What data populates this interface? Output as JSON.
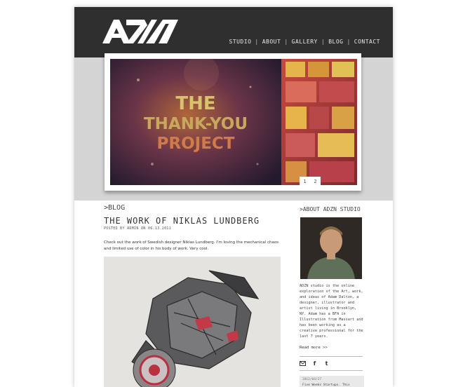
{
  "brand": {
    "logo_text": "ADZN"
  },
  "nav": {
    "items": [
      "STUDIO",
      "ABOUT",
      "GALLERY",
      "BLOG",
      "CONTACT"
    ],
    "separator": "|"
  },
  "slider": {
    "headline": [
      "THE",
      "THANK-YOU",
      "PROJECT"
    ],
    "pager": [
      "1",
      "2"
    ]
  },
  "blog": {
    "section_label": ">BLOG",
    "post": {
      "title": "THE WORK OF NIKLAS LUNDBERG",
      "meta": "POSTED BY ADMIN ON 06.13.2011",
      "body": "Check out the work of Swedish designer Niklas Lundberg. I'm loving the mechanical chaos and limited use of color in his body of work. Very cool."
    }
  },
  "sidebar": {
    "about_label": ">ABOUT ADZN STUDIO",
    "about_text": "ADZN studio is the online exploration of the Art, work, and ideas of Adam Dalton, a designer, illustrator and artist living in Brooklyn, NY. Adam has a BFA in Illustration from Massart and has been working as a creative professional for the last 7 years.",
    "read_more": "Read more >>",
    "social_icons": [
      "mail-icon",
      "facebook-icon",
      "twitter-icon"
    ],
    "latest": {
      "date": "2012/04/27",
      "title": "Five Weeks Startups. This"
    }
  },
  "colors": {
    "header_bg": "#2f2f2f",
    "band_bg": "#d4d4d4",
    "nav_text": "#e8e8e8"
  }
}
